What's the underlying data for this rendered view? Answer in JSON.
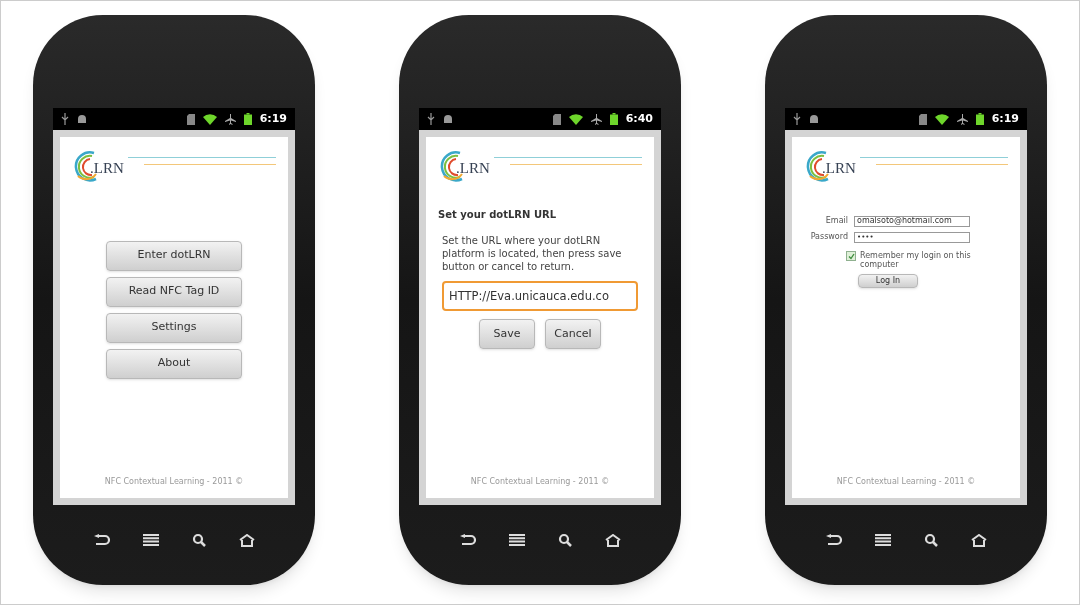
{
  "phones": [
    {
      "kind": "menu",
      "status_time": "6:19",
      "logo": ".LRN",
      "buttons": [
        "Enter dotLRN",
        "Read NFC Tag ID",
        "Settings",
        "About"
      ],
      "footer": "NFC Contextual Learning - 2011 ©"
    },
    {
      "kind": "url",
      "status_time": "6:40",
      "logo": ".LRN",
      "heading": "Set your dotLRN URL",
      "description": "Set the URL where your dotLRN platform is located, then press save button or cancel to return.",
      "url_value": "HTTP://Eva.unicauca.edu.co",
      "buttons": [
        "Save",
        "Cancel"
      ],
      "footer": "NFC Contextual Learning - 2011 ©"
    },
    {
      "kind": "login",
      "status_time": "6:19",
      "logo": ".LRN",
      "email_label": "Email",
      "email_value": "omalsoto@hotmail.com",
      "password_label": "Password",
      "password_value": "••••",
      "remember_label": "Remember my login on this computer",
      "remember_checked": true,
      "buttons": [
        "Log In"
      ],
      "footer": "NFC Contextual Learning - 2011 ©"
    }
  ]
}
